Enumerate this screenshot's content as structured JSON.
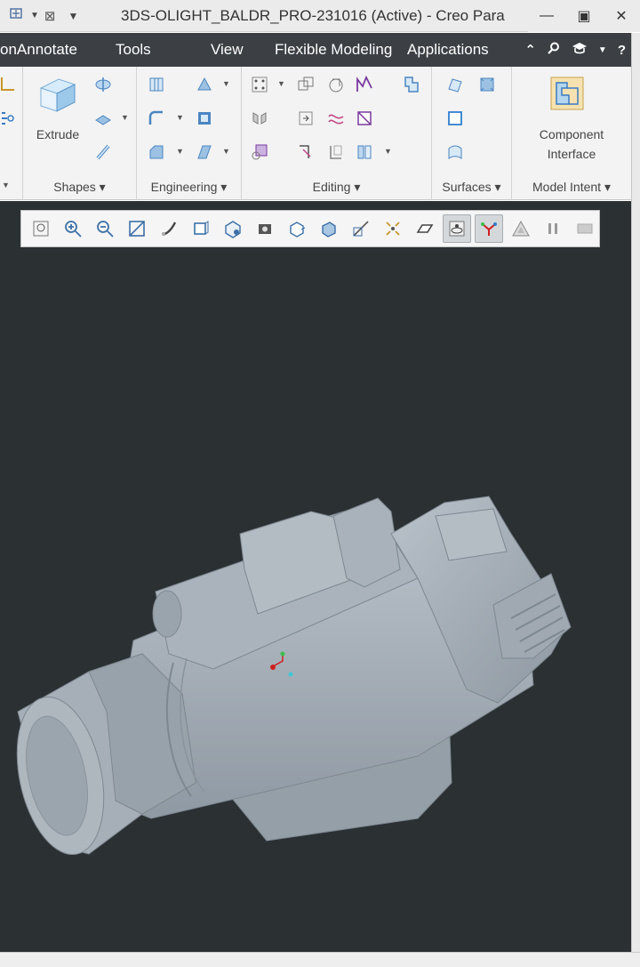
{
  "window": {
    "title": "3DS-OLIGHT_BALDR_PRO-231016 (Active) - Creo Para",
    "controls": [
      "minimize",
      "maximize",
      "close"
    ]
  },
  "quick_access": [
    "repaint-icon",
    "dropdown-icon",
    "close-window-icon",
    "customize-icon"
  ],
  "menu": {
    "tabs": [
      "onAnnotate",
      "Tools",
      "View",
      "Flexible Modeling",
      "Applications"
    ],
    "right_icons": [
      "collapse-ribbon-icon",
      "search-icon",
      "help-center-icon",
      "dropdown-icon",
      "help-icon"
    ]
  },
  "ribbon": {
    "groups": [
      {
        "id": "shapes",
        "label": "Shapes ▾",
        "big_button": "Extrude"
      },
      {
        "id": "engineering",
        "label": "Engineering ▾"
      },
      {
        "id": "editing",
        "label": "Editing ▾"
      },
      {
        "id": "surfaces",
        "label": "Surfaces ▾"
      },
      {
        "id": "model-intent",
        "label": "Model Intent ▾",
        "big_button_line1": "Component",
        "big_button_line2": "Interface"
      }
    ]
  },
  "view_toolbar": {
    "icons": [
      "refit-icon",
      "zoom-in-icon",
      "zoom-out-icon",
      "repaint-icon",
      "perspective-icon",
      "saved-orientations-icon",
      "view-manager-icon",
      "display-style-icon",
      "camera-icon",
      "section-icon",
      "appearance-icon",
      "datum-display-icon",
      "annotation-display-icon",
      "spin-center-icon",
      "show-axis-icon",
      "csys-display-icon",
      "triangle-icon",
      "pause-icon",
      "disabled-icon"
    ],
    "active": [
      "show-axis-icon",
      "csys-display-icon"
    ]
  },
  "colors": {
    "titlebar": "#ebebeb",
    "menubar": "#3c4045",
    "ribbon": "#f3f3f3",
    "graphics_bg": "#2b3033",
    "model": "#a7b0b8",
    "accent_blue": "#2f7fd0"
  },
  "model": {
    "name": "OLIGHT BALDR PRO tactical flashlight",
    "triad": [
      "x-axis-red",
      "y-axis-green",
      "z-axis-cyan"
    ]
  }
}
